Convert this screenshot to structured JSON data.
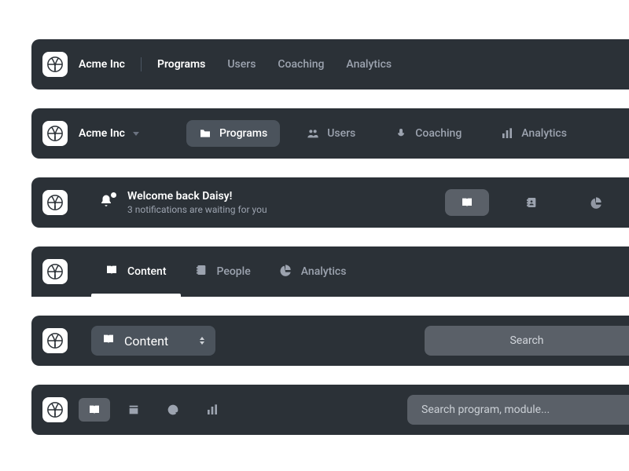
{
  "company": "Acme Inc",
  "nav1": {
    "items": [
      {
        "label": "Programs",
        "active": true
      },
      {
        "label": "Users"
      },
      {
        "label": "Coaching"
      },
      {
        "label": "Analytics"
      }
    ]
  },
  "nav2": {
    "items": [
      {
        "label": "Programs",
        "icon": "folder",
        "active": true
      },
      {
        "label": "Users",
        "icon": "users"
      },
      {
        "label": "Coaching",
        "icon": "mic"
      },
      {
        "label": "Analytics",
        "icon": "bars"
      }
    ]
  },
  "welcome": {
    "title": "Welcome back Daisy!",
    "subtitle": "3 notifications are waiting for you"
  },
  "iconbar": {
    "items": [
      {
        "icon": "book",
        "active": true
      },
      {
        "icon": "contacts"
      },
      {
        "icon": "pie"
      }
    ]
  },
  "tabs": {
    "items": [
      {
        "label": "Content",
        "icon": "book",
        "active": true
      },
      {
        "label": "People",
        "icon": "contacts"
      },
      {
        "label": "Analytics",
        "icon": "pie"
      }
    ]
  },
  "select": {
    "label": "Content",
    "icon": "book"
  },
  "search_btn": "Search",
  "miniIcons": {
    "items": [
      {
        "icon": "book",
        "active": true
      },
      {
        "icon": "layers"
      },
      {
        "icon": "at"
      },
      {
        "icon": "bars"
      }
    ]
  },
  "search": {
    "placeholder": "Search program, module..."
  }
}
